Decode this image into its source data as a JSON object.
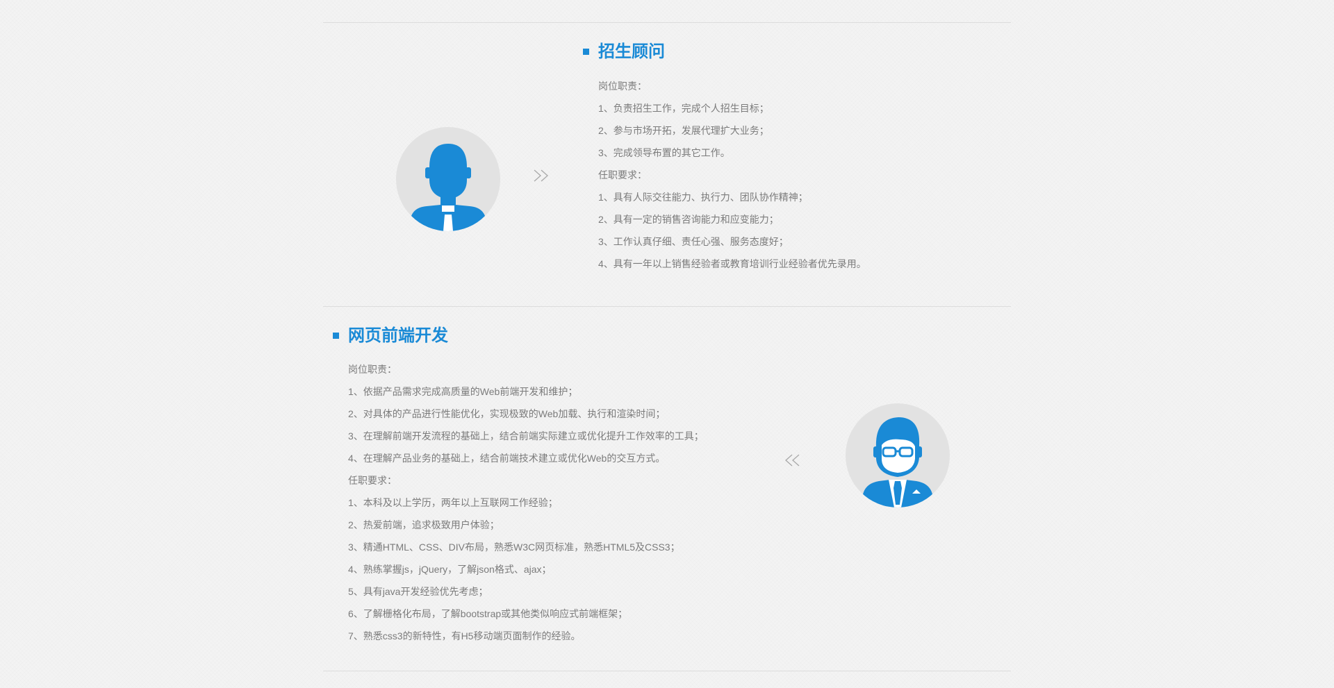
{
  "jobs": [
    {
      "title": "招生顾问",
      "lines": [
        "岗位职责：",
        "1、负责招生工作，完成个人招生目标；",
        "2、参与市场开拓，发展代理扩大业务；",
        "3、完成领导布置的其它工作。",
        "任职要求：",
        "1、具有人际交往能力、执行力、团队协作精神；",
        "2、具有一定的销售咨询能力和应变能力；",
        "3、工作认真仔细、责任心强、服务态度好；",
        "4、具有一年以上销售经验者或教育培训行业经验者优先录用。"
      ],
      "avatar_icon": "man-with-tie-avatar-icon",
      "arrow_icon": "double-chevron-right-icon"
    },
    {
      "title": "网页前端开发",
      "lines": [
        "岗位职责：",
        "1、依据产品需求完成高质量的Web前端开发和维护；",
        "2、对具体的产品进行性能优化，实现极致的Web加载、执行和渲染时间；",
        "3、在理解前端开发流程的基础上，结合前端实际建立或优化提升工作效率的工具；",
        "4、在理解产品业务的基础上，结合前端技术建立或优化Web的交互方式。",
        "任职要求：",
        "1、本科及以上学历，两年以上互联网工作经验；",
        "2、热爱前端，追求极致用户体验；",
        "3、精通HTML、CSS、DIV布局，熟悉W3C网页标准，熟悉HTML5及CSS3；",
        "4、熟练掌握js，jQuery，了解json格式、ajax；",
        "5、具有java开发经验优先考虑；",
        "6、了解栅格化布局，了解bootstrap或其他类似响应式前端框架；",
        "7、熟悉css3的新特性，有H5移动端页面制作的经验。"
      ],
      "avatar_icon": "man-with-glasses-avatar-icon",
      "arrow_icon": "double-chevron-left-icon"
    }
  ],
  "colors": {
    "accent": "#1a8ad6",
    "body_text": "#7b7b7b",
    "divider": "#dcdcdc",
    "avatar_bg": "#e2e2e2",
    "page_bg": "#f3f3f3"
  }
}
